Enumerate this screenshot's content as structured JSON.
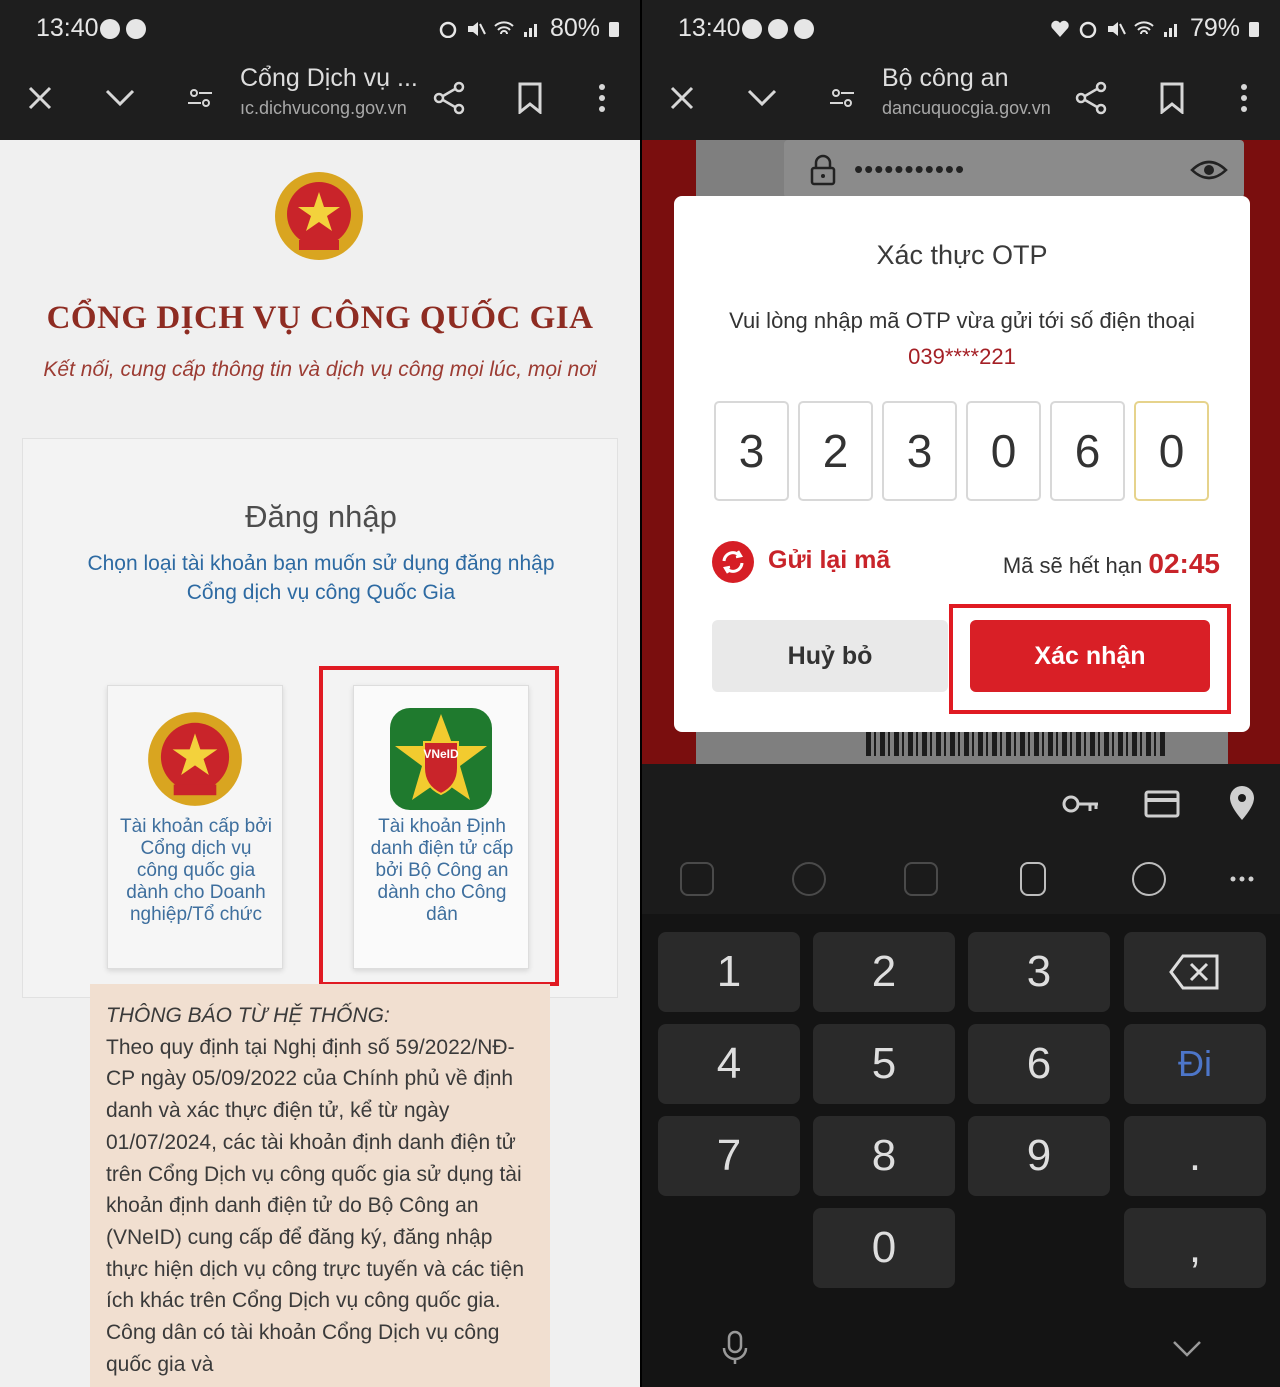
{
  "left": {
    "status": {
      "time": "13:40",
      "battery": "80%"
    },
    "toolbar": {
      "title": "Cổng Dịch vụ ...",
      "url": "ıc.dichvucong.gov.vn"
    },
    "site": {
      "title": "CỔNG DỊCH VỤ CÔNG QUỐC GIA",
      "subtitle": "Kết nối, cung cấp thông tin và dịch vụ công mọi lúc, mọi nơi"
    },
    "login": {
      "title": "Đăng nhập",
      "desc_line1": "Chọn loại tài khoản bạn muốn sử dụng đăng nhập",
      "desc_line2": "Cổng dịch vụ công Quốc Gia",
      "account_business": "Tài khoản cấp bởi Cổng dịch vụ công quốc gia dành cho Doanh nghiệp/Tổ chức",
      "account_citizen": "Tài khoản Định danh điện tử cấp bởi Bộ Công an dành cho Công dân",
      "vneid_badge": "VNeID"
    },
    "notice": {
      "title": "THÔNG BÁO TỪ HỆ THỐNG:",
      "body": "Theo quy định tại Nghị định số 59/2022/NĐ-CP ngày 05/09/2022 của Chính phủ về định danh và xác thực điện tử, kể từ ngày 01/07/2024, các tài khoản định danh điện tử trên Cổng Dịch vụ công quốc gia sử dụng tài khoản định danh điện tử do Bộ Công an (VNeID) cung cấp để đăng ký, đăng nhập thực hiện dịch vụ công trực tuyến và các tiện ích khác trên Cổng Dịch vụ công quốc gia. Công dân có tài khoản Cổng Dịch vụ công quốc gia và"
    }
  },
  "right": {
    "status": {
      "time": "13:40",
      "battery": "79%"
    },
    "toolbar": {
      "title": "Bộ công an",
      "url": "dancuquocgia.gov.vn"
    },
    "password_mask": "•••••••••••",
    "otp": {
      "title": "Xác thực OTP",
      "desc": "Vui lòng nhập mã OTP vừa gửi tới số điện thoại",
      "phone": "039****221",
      "digits": [
        "3",
        "2",
        "3",
        "0",
        "6",
        "0"
      ],
      "resend": "Gửi lại mã",
      "expiry_label": "Mã sẽ hết hạn",
      "expiry_time": "02:45",
      "cancel": "Huỷ bỏ",
      "confirm": "Xác nhận"
    },
    "keyboard": {
      "keys": [
        "1",
        "2",
        "3",
        "4",
        "5",
        "6",
        "Đi",
        "7",
        "8",
        "9",
        ".",
        "0",
        ","
      ]
    }
  }
}
